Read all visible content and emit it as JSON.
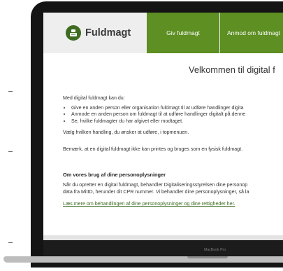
{
  "device": {
    "model_label": "MacBook Pro"
  },
  "header": {
    "brand": "Fuldmagt",
    "tabs": [
      {
        "label": "Giv fuldmagt"
      },
      {
        "label": "Anmod om fuldmagt"
      }
    ]
  },
  "main": {
    "welcome": "Velkommen til digital f",
    "intro": "Med digital fuldmagt kan du:",
    "bullets": [
      "Give en anden person eller organisation fuldmagt til at udføre handlinger digita",
      "Anmode en anden person om fuldmagt til at udføre handlinger digitalt på denne",
      "Se, hvilke fuldmagter du har afgivet eller modtaget."
    ],
    "choose": "Vælg hvilken handling, du ønsker at udføre, i topmenuen.",
    "note": "Bemærk, at en digital fuldmagt ikke kan printes og bruges som en fysisk fuldmagt.",
    "privacy": {
      "title": "Om vores brug af dine personoplysninger",
      "text_line1": "Når du opretter en digital fuldmagt, behandler Digitaliseringsstyrelsen dine personop",
      "text_line2": "data fra MitID, herunder dit CPR nummer. Vi behandler dine personoplysninger, så la",
      "link": "Læs mere om behandlingen af dine personoplysninger og dine rettigheder her."
    }
  }
}
